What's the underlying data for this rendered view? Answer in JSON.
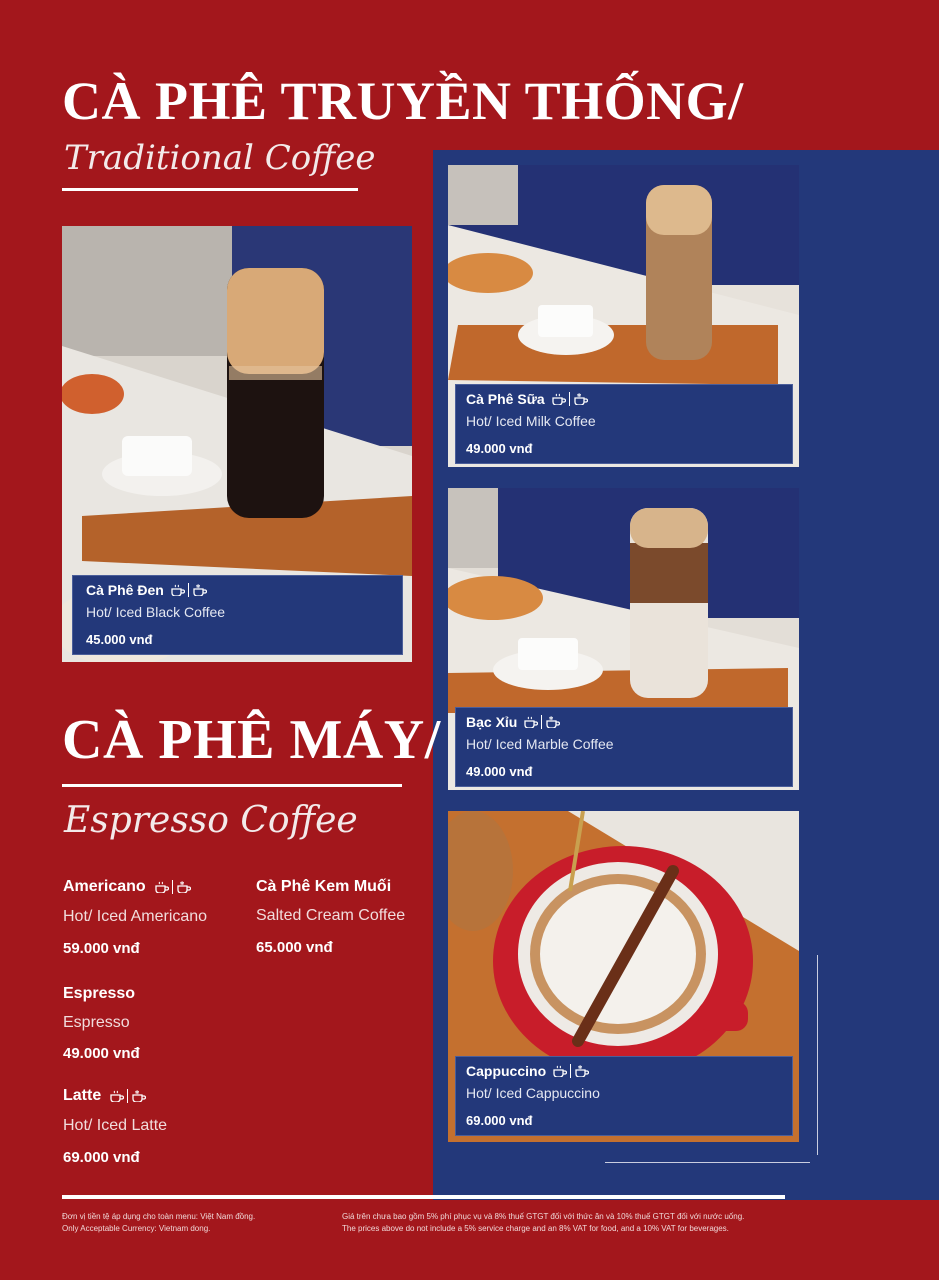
{
  "section1": {
    "title": "CÀ PHÊ TRUYỀN THỐNG/",
    "subtitle": "Traditional Coffee"
  },
  "section2": {
    "title": "CÀ PHÊ MÁY/",
    "subtitle": "Espresso Coffee"
  },
  "cards": [
    {
      "name": "Cà Phê Đen",
      "desc": "Hot/ Iced Black Coffee",
      "price": "45.000 vnđ",
      "icon": "hot-iced-icons"
    },
    {
      "name": "Cà Phê Sữa",
      "desc": "Hot/ Iced Milk Coffee",
      "price": "49.000 vnđ",
      "icon": "hot-iced-icons"
    },
    {
      "name": "Bạc Xỉu",
      "desc": "Hot/ Iced Marble Coffee",
      "price": "49.000 vnđ",
      "icon": "hot-iced-icons"
    },
    {
      "name": "Cappuccino",
      "desc": "Hot/ Iced Cappuccino",
      "price": "69.000 vnđ",
      "icon": "hot-iced-icons"
    }
  ],
  "espresso_items": [
    {
      "name": "Americano",
      "desc": "Hot/ Iced Americano",
      "price": "59.000 vnđ",
      "icon": "hot-iced-icons"
    },
    {
      "name": "Cà Phê Kem Muối",
      "desc": "Salted Cream Coffee",
      "price": "65.000 vnđ"
    },
    {
      "name": "Espresso",
      "desc": "Espresso",
      "price": "49.000 vnđ"
    },
    {
      "name": "Latte",
      "desc": "Hot/ Iced Latte",
      "price": "69.000 vnđ",
      "icon": "hot-iced-icons"
    }
  ],
  "footer": {
    "currency_vi": "Đơn vị tiền tệ áp dụng cho toàn menu: Việt Nam đồng.",
    "currency_en": "Only Acceptable Currency: Vietnam dong.",
    "tax_vi": "Giá trên chưa bao gồm 5% phí phục vụ và 8% thuế GTGT đối với thức ăn và 10% thuế GTGT đối với nước uống.",
    "tax_en": "The prices above do not include a 5% service charge and an 8% VAT for food, and a 10% VAT for beverages."
  },
  "colors": {
    "red": "#a3171c",
    "blue": "#23387a"
  }
}
